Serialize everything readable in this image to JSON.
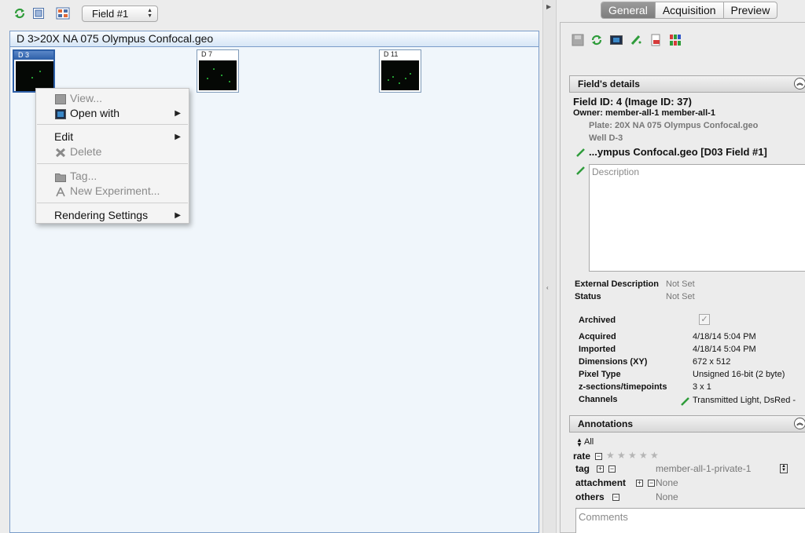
{
  "left": {
    "field_select": "Field #1",
    "browser_title": "D 3>20X NA 075 Olympus Confocal.geo",
    "thumbnails": [
      {
        "label": "D 3"
      },
      {
        "label": "D 7"
      },
      {
        "label": "D 11"
      }
    ],
    "context_menu": {
      "view": "View...",
      "open_with": "Open with",
      "edit": "Edit",
      "delete": "Delete",
      "tag": "Tag...",
      "new_experiment": "New Experiment...",
      "rendering_settings": "Rendering Settings",
      "submenu_arrow": "▶"
    }
  },
  "right": {
    "tabs": [
      "General",
      "Acquisition",
      "Preview"
    ],
    "active_tab": "General",
    "field_details_header": "Field's details",
    "field_id": "Field ID: 4 (Image ID: 37)",
    "owner": "Owner: member-all-1 member-all-1",
    "plate": "Plate: 20X NA 075 Olympus Confocal.geo",
    "well": "Well D-3",
    "name": "...ympus Confocal.geo [D03 Field #1]",
    "description_placeholder": "Description",
    "external_description_label": "External Description",
    "external_description_value": "Not Set",
    "status_label": "Status",
    "status_value": "Not Set",
    "properties": [
      {
        "label": "Archived",
        "value": "✓"
      },
      {
        "label": "Acquired",
        "value": "4/18/14 5:04 PM"
      },
      {
        "label": "Imported",
        "value": "4/18/14 5:04 PM"
      },
      {
        "label": "Dimensions (XY)",
        "value": "672 x 512"
      },
      {
        "label": "Pixel Type",
        "value": "Unsigned 16-bit (2 byte)"
      },
      {
        "label": "z-sections/timepoints",
        "value": "3 x 1"
      },
      {
        "label": "Channels",
        "value": "Transmitted Light, DsRed -"
      }
    ],
    "annotations_header": "Annotations",
    "all_label": "All",
    "rate_label": "rate",
    "rating": 0,
    "tag_label": "tag",
    "tag_value": "member-all-1-private-1",
    "attachment_label": "attachment",
    "attachment_value": "None",
    "others_label": "others",
    "others_value": "None",
    "comments_placeholder": "Comments",
    "collapse_glyph": "︽"
  },
  "colors": {
    "selection": "#2d5fa8",
    "panel_border": "#7a9cc9",
    "refresh_green": "#2e9c3a"
  }
}
